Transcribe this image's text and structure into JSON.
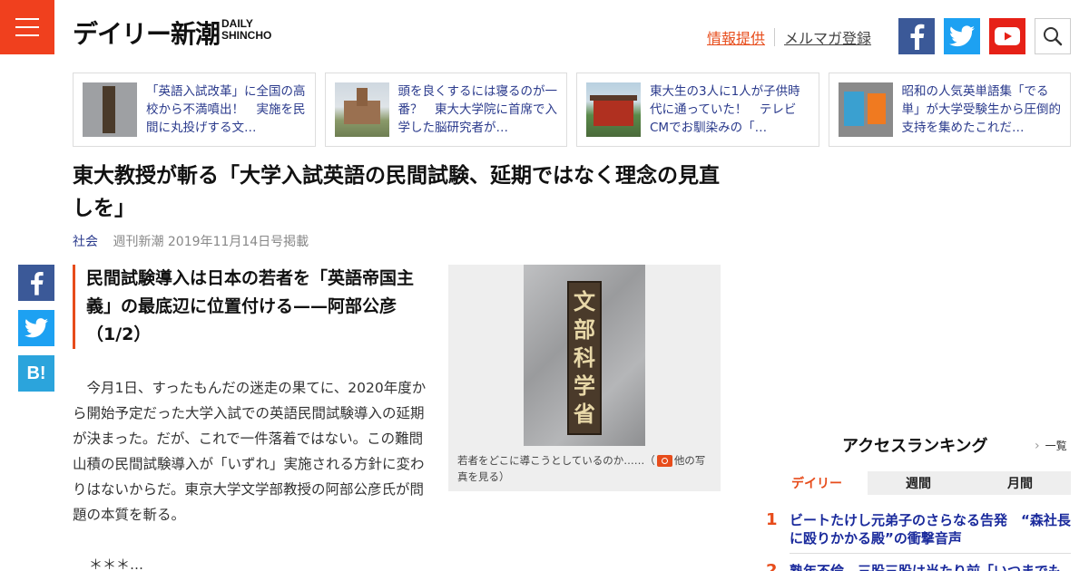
{
  "header": {
    "logo_jp": "デイリー新潮",
    "logo_en_1": "DAILY",
    "logo_en_2": "SHINCHO",
    "link_info": "情報提供",
    "link_mail": "メルマガ登録"
  },
  "related": [
    {
      "text": "「英語入試改革」に全国の高校から不満噴出！　実施を民間に丸投げする文…"
    },
    {
      "text": "頭を良くするには寝るのが一番？　東大大学院に首席で入学した脳研究者が…"
    },
    {
      "text": "東大生の3人に1人が子供時代に通っていた！　テレビCMでお馴染みの「…"
    },
    {
      "text": "昭和の人気英単語集「でる単」が大学受験生から圧倒的支持を集めたこれだ…"
    }
  ],
  "article": {
    "title": "東大教授が斬る「大学入試英語の民間試験、延期ではなく理念の見直しを」",
    "category": "社会",
    "source": "週刊新潮 2019年11月14日号掲載",
    "subtitle": "民間試験導入は日本の若者を「英語帝国主義」の最底辺に位置付ける——阿部公彦（1/2）",
    "body": "今月1日、すったもんだの迷走の果てに、2020年度から開始予定だった大学入試での英語民間試験導入の延期が決まった。だが、これで一件落着ではない。この難問山積の民間試験導入が「いずれ」実施される方針に変わりはないからだ。東京大学文学部教授の阿部公彦氏が問題の本質を斬る。",
    "stars": "＊＊＊…"
  },
  "figure": {
    "plaque_chars": [
      "文",
      "部",
      "科",
      "学",
      "省"
    ],
    "caption_pre": "若者をどこに導こうとしているのか……（",
    "caption_link": "他の写真を見る",
    "caption_post": "）"
  },
  "share": {
    "hatena_label": "B!"
  },
  "ranking": {
    "title": "アクセスランキング",
    "more": "一覧",
    "tabs": [
      "デイリー",
      "週間",
      "月間"
    ],
    "items": [
      {
        "num": "1",
        "text": "ビートたけし元弟子のさらなる告発　“森社長に殴りかかる殿”の衝撃音声"
      },
      {
        "num": "2",
        "text": "熟年不倫　三股三股は当たり前「いつまでもSEX"
      }
    ]
  },
  "colors": {
    "accent": "#e74c1b",
    "link": "#2a3a8c",
    "facebook": "#3b5998",
    "twitter": "#1da1f2",
    "youtube": "#e62117"
  }
}
